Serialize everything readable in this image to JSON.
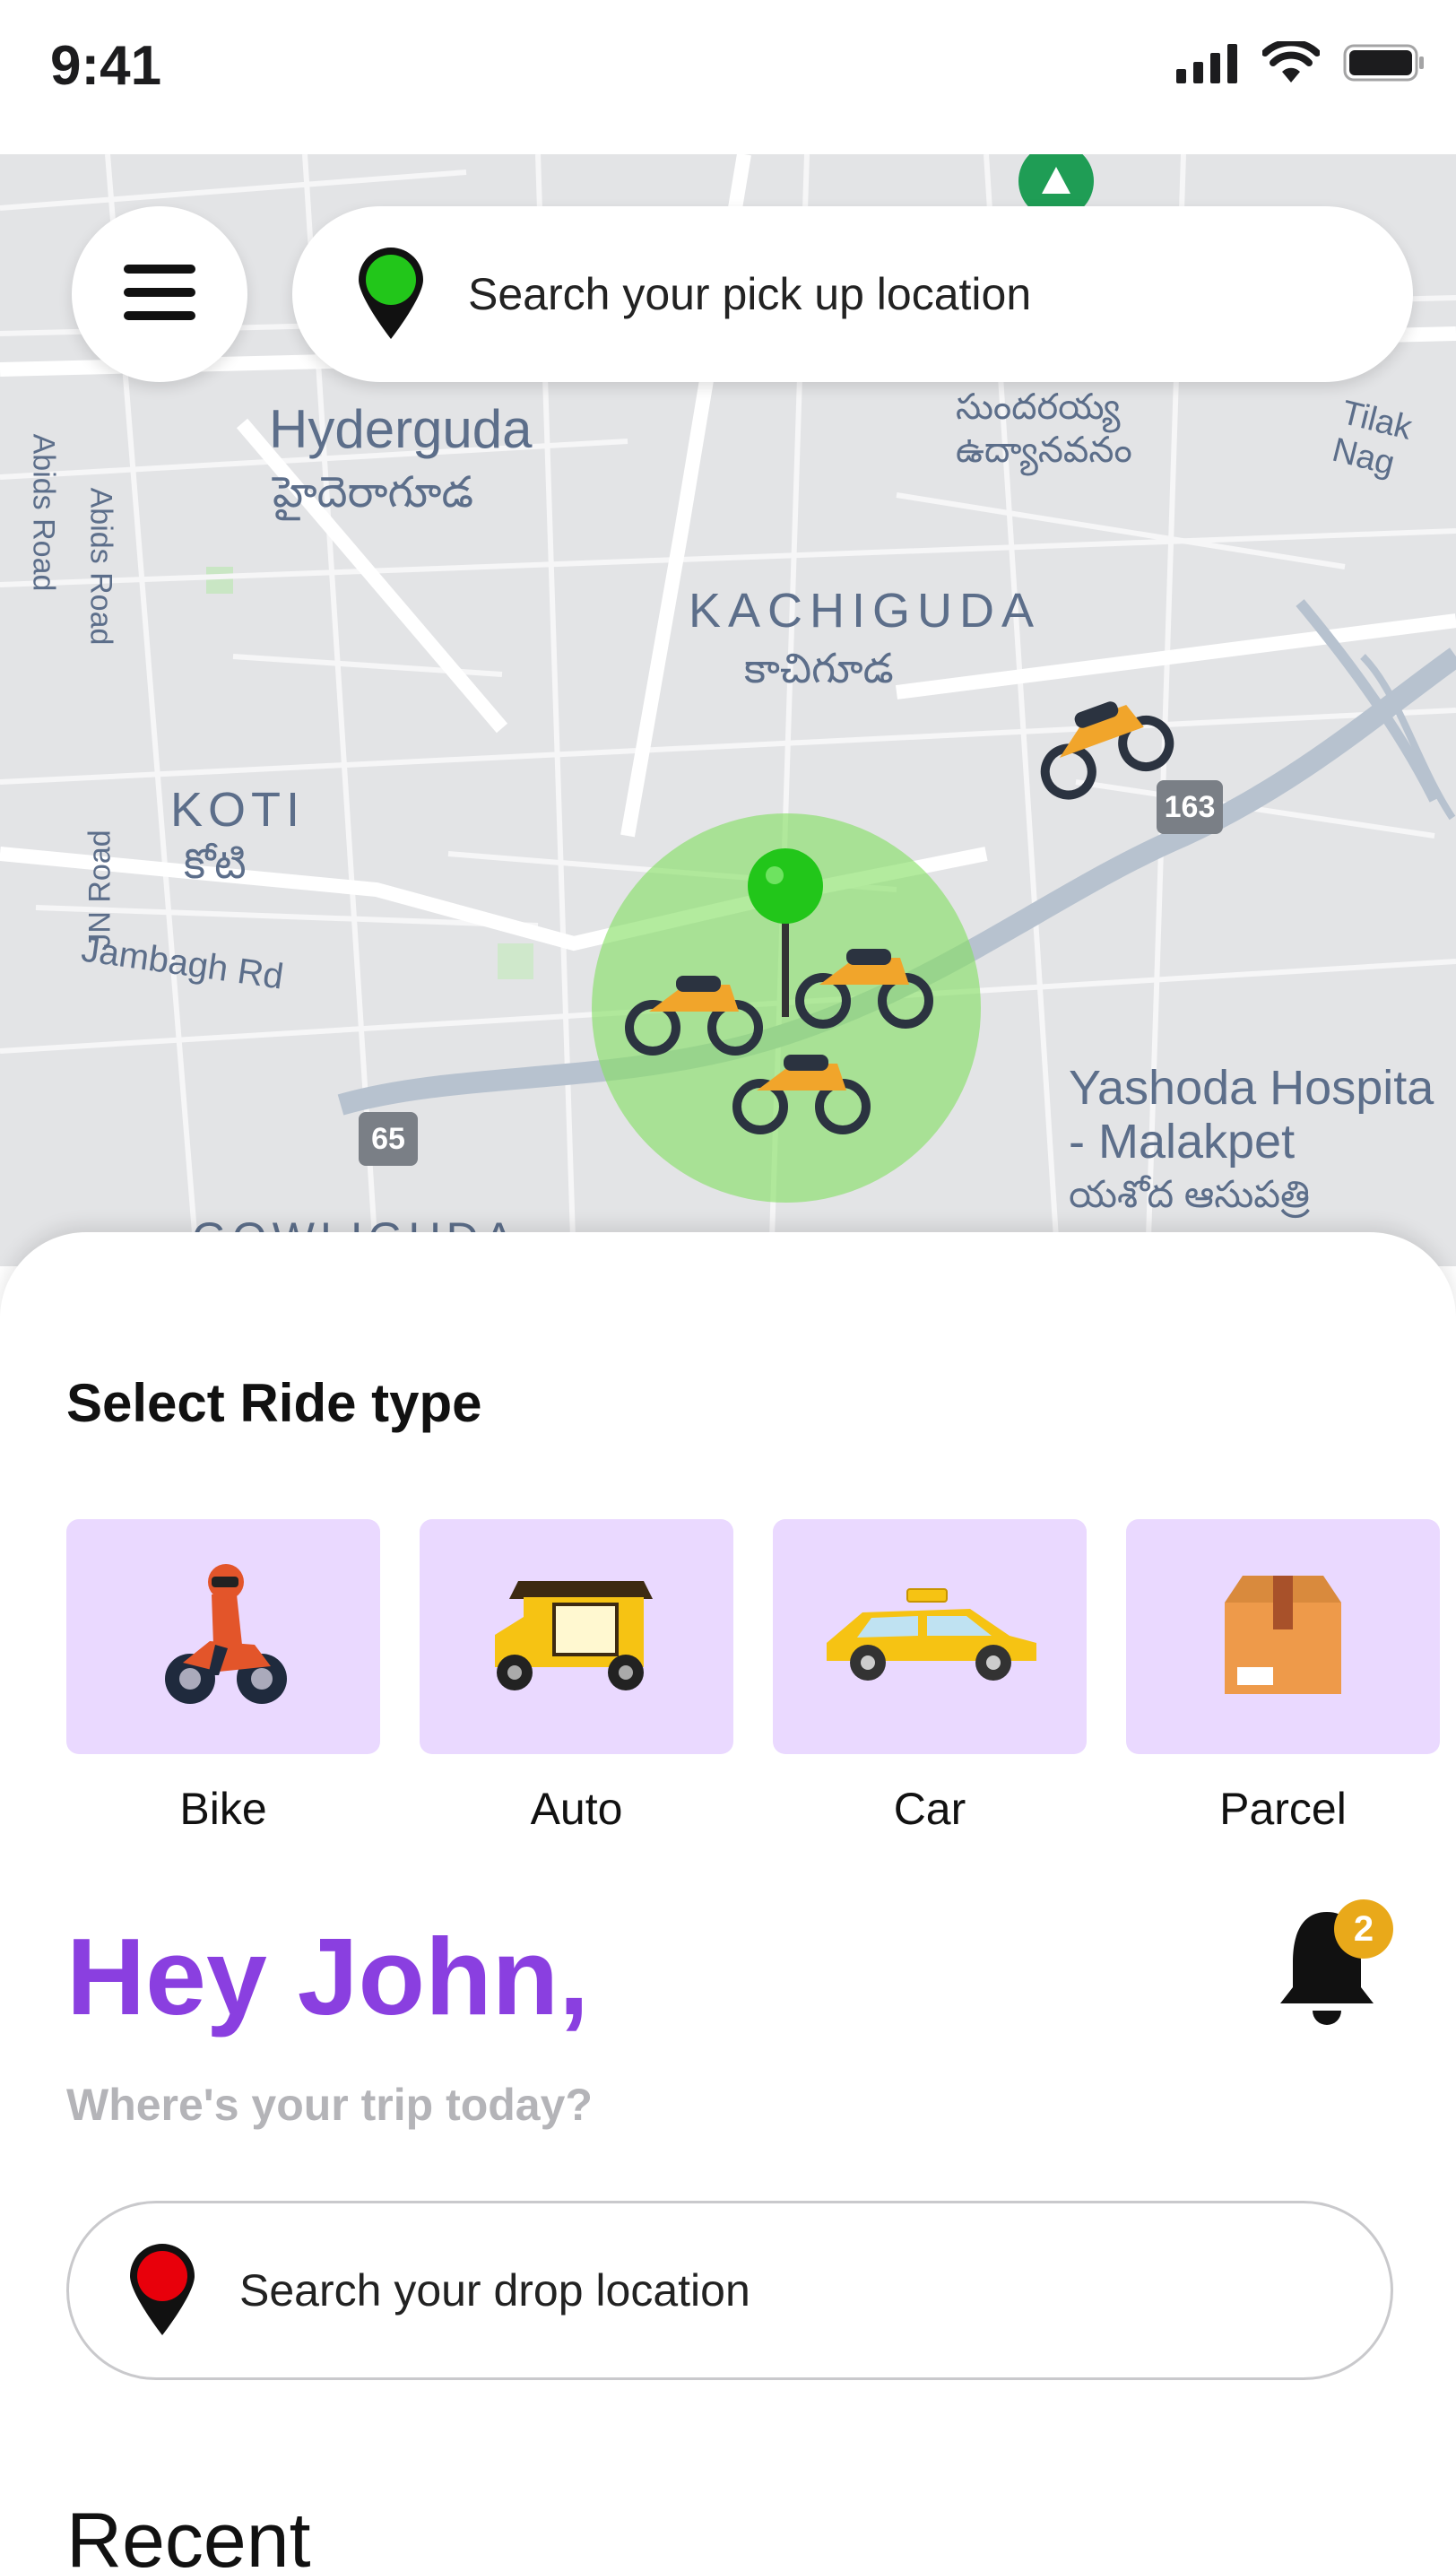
{
  "status_bar": {
    "time": "9:41",
    "icons": [
      "signal-icon",
      "wifi-icon",
      "battery-icon"
    ]
  },
  "map": {
    "labels": {
      "hyderguda": "Hyderguda",
      "hyderguda_te": "హైదెరాగూడ",
      "kachiguda": "KACHIGUDA",
      "kachiguda_te": "కాచిగూడ",
      "koti": "KOTI",
      "koti_te": "కోటి",
      "jambagh": "Jambagh Rd",
      "abids1": "Abids Road",
      "abids2": "Abids Road",
      "jn_road": "JN Road",
      "sundaraiah_te": "సుందరయ్య ఉద్యానవనం",
      "tilak": "Tilak Nag",
      "yashoda1": "Yashoda Hospita",
      "yashoda2": "- Malakpet",
      "yashoda_te": "యశోద ఆసుపత్రి",
      "gowliguda": "GOWLIGUDA",
      "shield_163": "163",
      "shield_65": "65"
    },
    "pickup_search": {
      "placeholder": "Search your pick up location"
    }
  },
  "sheet": {
    "section_title": "Select Ride type",
    "ride_types": [
      {
        "label": "Bike",
        "icon": "bike-icon"
      },
      {
        "label": "Auto",
        "icon": "auto-rickshaw-icon"
      },
      {
        "label": "Car",
        "icon": "taxi-car-icon"
      },
      {
        "label": "Parcel",
        "icon": "parcel-box-icon"
      }
    ],
    "greeting": "Hey John,",
    "subtitle": "Where's your trip today?",
    "notifications": {
      "count": "2"
    },
    "drop_search": {
      "placeholder": "Search your drop location"
    },
    "recent_title": "Recent"
  },
  "colors": {
    "accent": "#8a3fe0",
    "tile_bg": "#ead9ff",
    "pickup_pin": "#22c61a",
    "drop_pin": "#e8000b",
    "badge": "#e9a91a",
    "radius_fill": "#9be27d"
  }
}
